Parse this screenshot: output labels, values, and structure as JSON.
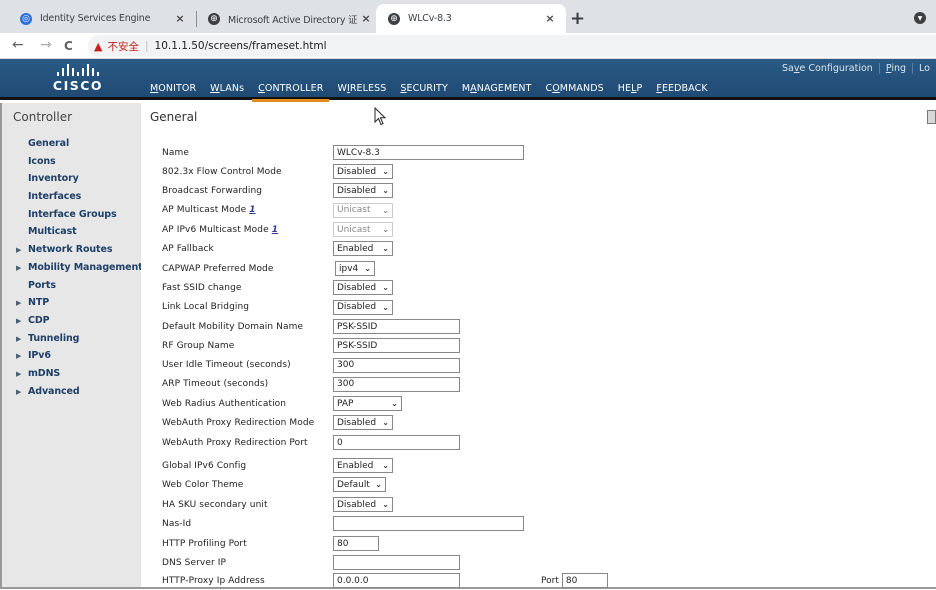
{
  "browser": {
    "tabs": [
      {
        "title": "Identity Services Engine",
        "icon": "ise-icon"
      },
      {
        "title": "Microsoft Active Directory 证书服",
        "icon": "globe-icon"
      },
      {
        "title": "WLCv-8.3",
        "icon": "globe-icon",
        "active": true
      }
    ],
    "new_tab": "+",
    "close_glyph": "×",
    "nav": {
      "back": "←",
      "forward": "→",
      "reload": "C"
    },
    "security_warning": "不安全",
    "url": "10.1.1.50/screens/frameset.html"
  },
  "header": {
    "brand": "CISCO",
    "nav": [
      {
        "label": "MONITOR",
        "ul": "M",
        "rest": "ONITOR"
      },
      {
        "label": "WLANs",
        "ul": "W",
        "rest": "LANs"
      },
      {
        "label": "CONTROLLER",
        "ul": "C",
        "rest": "ONTROLLER",
        "active": true
      },
      {
        "label": "WIRELESS",
        "pre": "W",
        "ul": "I",
        "rest": "RELESS"
      },
      {
        "label": "SECURITY",
        "ul": "S",
        "rest": "ECURITY"
      },
      {
        "label": "MANAGEMENT",
        "pre": "M",
        "ul": "A",
        "rest": "NAGEMENT"
      },
      {
        "label": "COMMANDS",
        "pre": "C",
        "ul": "O",
        "rest": "MMANDS"
      },
      {
        "label": "HELP",
        "pre": "HE",
        "ul": "L",
        "rest": "P"
      },
      {
        "label": "FEEDBACK",
        "ul": "F",
        "rest": "EEDBACK"
      }
    ],
    "links": [
      {
        "label": "Save Configuration",
        "pre": "Sa",
        "ul": "v",
        "rest": "e Configuration"
      },
      {
        "label": "Ping",
        "ul": "P",
        "rest": "ing"
      },
      {
        "label": "Lo",
        "pre": "Lo"
      }
    ]
  },
  "sidebar": {
    "title": "Controller",
    "items": [
      {
        "label": "General",
        "expandable": false
      },
      {
        "label": "Icons",
        "expandable": false
      },
      {
        "label": "Inventory",
        "expandable": false
      },
      {
        "label": "Interfaces",
        "expandable": false
      },
      {
        "label": "Interface Groups",
        "expandable": false
      },
      {
        "label": "Multicast",
        "expandable": false
      },
      {
        "label": "Network Routes",
        "expandable": true
      },
      {
        "label": "Mobility Management",
        "expandable": true
      },
      {
        "label": "Ports",
        "expandable": false
      },
      {
        "label": "NTP",
        "expandable": true
      },
      {
        "label": "CDP",
        "expandable": true
      },
      {
        "label": "Tunneling",
        "expandable": true
      },
      {
        "label": "IPv6",
        "expandable": true
      },
      {
        "label": "mDNS",
        "expandable": true
      },
      {
        "label": "Advanced",
        "expandable": true
      }
    ]
  },
  "main": {
    "title": "General",
    "fields": [
      {
        "label": "Name",
        "type": "text",
        "value": "WLCv-8.3"
      },
      {
        "label": "802.3x Flow Control Mode",
        "type": "select",
        "value": "Disabled"
      },
      {
        "label": "Broadcast Forwarding",
        "type": "select",
        "value": "Disabled"
      },
      {
        "label": "AP Multicast Mode",
        "type": "select",
        "value": "Unicast",
        "info": "1",
        "disabled": true
      },
      {
        "label": "AP IPv6 Multicast Mode",
        "type": "select",
        "value": "Unicast",
        "info": "1",
        "disabled": true
      },
      {
        "label": "AP Fallback",
        "type": "select",
        "value": "Enabled"
      },
      {
        "label": "CAPWAP Preferred Mode",
        "type": "select",
        "value": "ipv4"
      },
      {
        "label": "Fast SSID change",
        "type": "select",
        "value": "Disabled"
      },
      {
        "label": "Link Local Bridging",
        "type": "select",
        "value": "Disabled"
      },
      {
        "label": "Default Mobility Domain Name",
        "type": "text",
        "value": "PSK-SSID"
      },
      {
        "label": "RF Group Name",
        "type": "text",
        "value": "PSK-SSID"
      },
      {
        "label": "User Idle Timeout (seconds)",
        "type": "text",
        "value": "300"
      },
      {
        "label": "ARP Timeout (seconds)",
        "type": "text",
        "value": "300"
      },
      {
        "label": "Web Radius Authentication",
        "type": "select",
        "value": "PAP"
      },
      {
        "label": "WebAuth Proxy Redirection Mode",
        "type": "select",
        "value": "Disabled"
      },
      {
        "label": "WebAuth Proxy Redirection Port",
        "type": "text",
        "value": "0"
      },
      {
        "label": "Global IPv6 Config",
        "type": "select",
        "value": "Enabled"
      },
      {
        "label": "Web Color Theme",
        "type": "select",
        "value": "Default"
      },
      {
        "label": "HA SKU secondary unit",
        "type": "select",
        "value": "Disabled"
      },
      {
        "label": "Nas-Id",
        "type": "text",
        "value": ""
      },
      {
        "label": "HTTP Profiling Port",
        "type": "text",
        "value": "80"
      },
      {
        "label": "DNS Server IP",
        "type": "text",
        "value": ""
      },
      {
        "label": "HTTP-Proxy Ip Address",
        "type": "text",
        "value": "0.0.0.0",
        "port_label": "Port",
        "port_value": "80"
      }
    ]
  },
  "colors": {
    "header_bg": "#1f4a73",
    "active_tab_underline": "#e48b1f",
    "sidebar_bg": "#e7e7e7",
    "sidebar_link": "#1e3f66",
    "warning": "#c5221f"
  }
}
